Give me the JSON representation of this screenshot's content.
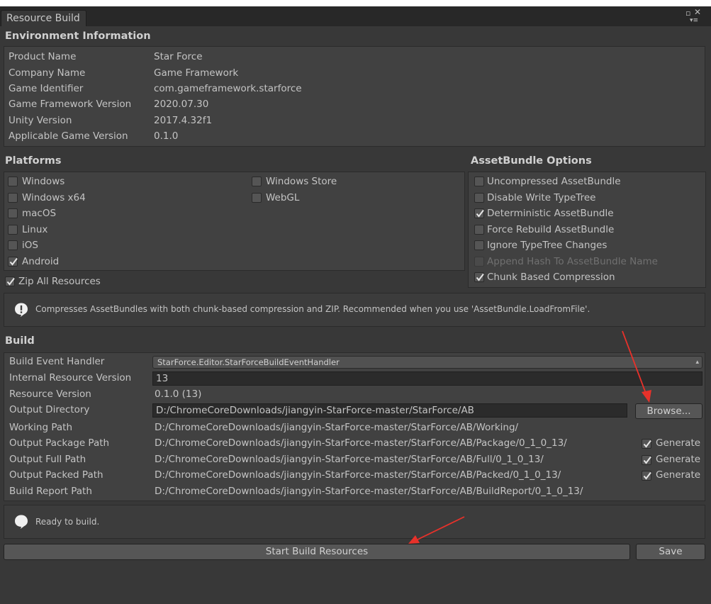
{
  "window": {
    "tab_title": "Resource Build"
  },
  "environment": {
    "header": "Environment Information",
    "rows": [
      {
        "label": "Product Name",
        "value": "Star Force"
      },
      {
        "label": "Company Name",
        "value": "Game Framework"
      },
      {
        "label": "Game Identifier",
        "value": "com.gameframework.starforce"
      },
      {
        "label": "Game Framework Version",
        "value": "2020.07.30"
      },
      {
        "label": "Unity Version",
        "value": "2017.4.32f1"
      },
      {
        "label": "Applicable Game Version",
        "value": "0.1.0"
      }
    ]
  },
  "platforms": {
    "header": "Platforms",
    "items": [
      {
        "label": "Windows",
        "checked": false
      },
      {
        "label": "Windows x64",
        "checked": false
      },
      {
        "label": "macOS",
        "checked": false
      },
      {
        "label": "Linux",
        "checked": false
      },
      {
        "label": "iOS",
        "checked": false
      },
      {
        "label": "Android",
        "checked": true
      },
      {
        "label": "Windows Store",
        "checked": false
      },
      {
        "label": "WebGL",
        "checked": false
      }
    ],
    "zip_all": {
      "label": "Zip All Resources",
      "checked": true
    }
  },
  "assetbundle": {
    "header": "AssetBundle Options",
    "options": [
      {
        "label": "Uncompressed AssetBundle",
        "checked": false,
        "enabled": true
      },
      {
        "label": "Disable Write TypeTree",
        "checked": false,
        "enabled": true
      },
      {
        "label": "Deterministic AssetBundle",
        "checked": true,
        "enabled": true
      },
      {
        "label": "Force Rebuild AssetBundle",
        "checked": false,
        "enabled": true
      },
      {
        "label": "Ignore TypeTree Changes",
        "checked": false,
        "enabled": true
      },
      {
        "label": "Append Hash To AssetBundle Name",
        "checked": false,
        "enabled": false
      },
      {
        "label": "Chunk Based Compression",
        "checked": true,
        "enabled": true
      }
    ]
  },
  "compression_help": "Compresses AssetBundles with both chunk-based compression and ZIP. Recommended when you use 'AssetBundle.LoadFromFile'.",
  "build": {
    "header": "Build",
    "event_handler_label": "Build Event Handler",
    "event_handler_value": "StarForce.Editor.StarForceBuildEventHandler",
    "internal_version_label": "Internal Resource Version",
    "internal_version_value": "13",
    "resource_version_label": "Resource Version",
    "resource_version_value": "0.1.0 (13)",
    "output_dir_label": "Output Directory",
    "output_dir_value": "D:/ChromeCoreDownloads/jiangyin-StarForce-master/StarForce/AB",
    "browse_label": "Browse...",
    "working_path_label": "Working Path",
    "working_path_value": "D:/ChromeCoreDownloads/jiangyin-StarForce-master/StarForce/AB/Working/",
    "package_path_label": "Output Package Path",
    "package_path_value": "D:/ChromeCoreDownloads/jiangyin-StarForce-master/StarForce/AB/Package/0_1_0_13/",
    "full_path_label": "Output Full Path",
    "full_path_value": "D:/ChromeCoreDownloads/jiangyin-StarForce-master/StarForce/AB/Full/0_1_0_13/",
    "packed_path_label": "Output Packed Path",
    "packed_path_value": "D:/ChromeCoreDownloads/jiangyin-StarForce-master/StarForce/AB/Packed/0_1_0_13/",
    "report_path_label": "Build Report Path",
    "report_path_value": "D:/ChromeCoreDownloads/jiangyin-StarForce-master/StarForce/AB/BuildReport/0_1_0_13/",
    "generate_label": "Generate",
    "generate_package": true,
    "generate_full": true,
    "generate_packed": true
  },
  "status_help": "Ready to build.",
  "actions": {
    "start_build_label": "Start Build Resources",
    "save_label": "Save"
  },
  "colors": {
    "background": "#383838",
    "panel": "#414141",
    "annotation_arrow": "#e8312a"
  }
}
